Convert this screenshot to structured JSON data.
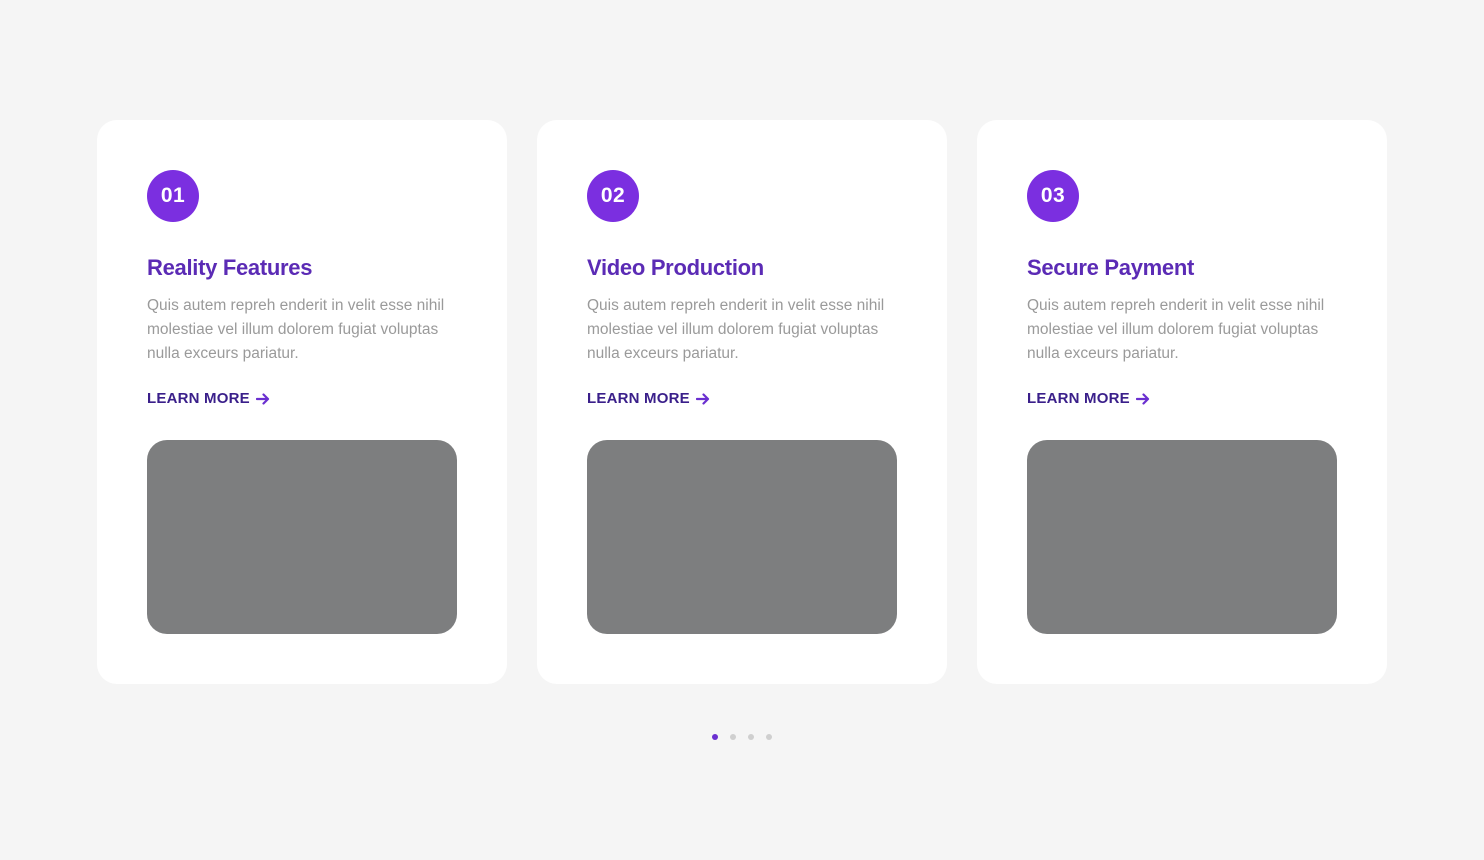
{
  "colors": {
    "background": "#f5f5f5",
    "card": "#ffffff",
    "accent": "#7b2fe0",
    "title": "#5b2bb5",
    "link": "#3a1f8a",
    "placeholder": "#7d7e7f",
    "dot_inactive": "#cfcfcf"
  },
  "cards": [
    {
      "number": "01",
      "title": "Reality Features",
      "description": "Quis autem repreh enderit in velit esse nihil molestiae vel illum dolorem fugiat voluptas nulla exceurs pariatur.",
      "link_label": "LEARN MORE",
      "link_icon": "arrow-right-icon"
    },
    {
      "number": "02",
      "title": "Video Production",
      "description": "Quis autem repreh enderit in velit esse nihil molestiae vel illum dolorem fugiat voluptas nulla exceurs pariatur.",
      "link_label": "LEARN MORE",
      "link_icon": "arrow-right-icon"
    },
    {
      "number": "03",
      "title": "Secure Payment",
      "description": "Quis autem repreh enderit in velit esse nihil molestiae vel illum dolorem fugiat voluptas nulla exceurs pariatur.",
      "link_label": "LEARN MORE",
      "link_icon": "arrow-right-icon"
    }
  ],
  "pagination": {
    "total": 4,
    "active": 1
  }
}
